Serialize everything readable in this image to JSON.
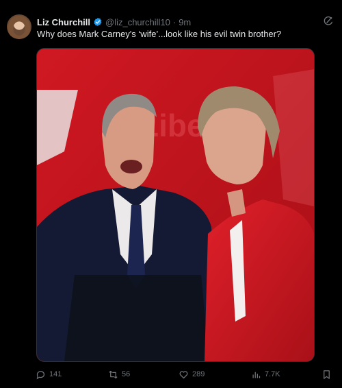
{
  "author": {
    "display_name": "Liz Churchill",
    "handle": "@liz_churchill10",
    "separator": "·",
    "time": "9m",
    "verified_icon": "verified-badge-icon",
    "badge_color": "#1d9bf0"
  },
  "post": {
    "text": "Why does Mark Carney's ‘wife’...look like his evil twin brother?"
  },
  "media": {
    "background_text": "Libe"
  },
  "actions": {
    "replies": "141",
    "reposts": "56",
    "likes": "289",
    "views": "7.7K"
  },
  "colors": {
    "background": "#000000",
    "text": "#e7e9ea",
    "muted": "#71767b",
    "accent": "#1d9bf0",
    "media_red": "#c8141d"
  }
}
